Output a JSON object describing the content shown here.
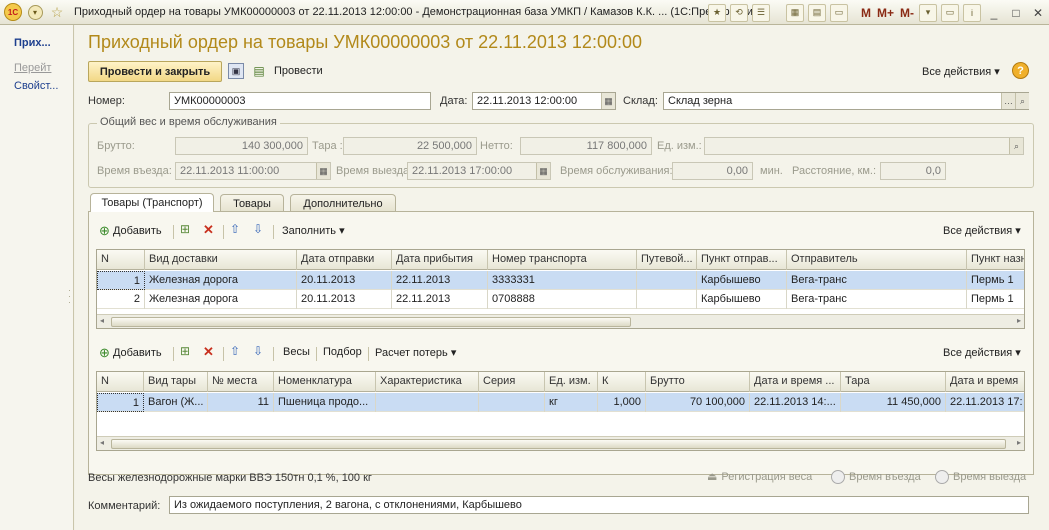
{
  "window": {
    "title": "Приходный ордер на товары УМК00000003 от 22.11.2013 12:00:00 - Демонстрационная база УМКП / Камазов К.К. ... (1С:Предприятие)",
    "toolbar_m": "M",
    "toolbar_mplus": "M+",
    "toolbar_mminus": "M-"
  },
  "sidebar": {
    "items": [
      {
        "label": "Прих..."
      },
      {
        "label": "Перейт"
      },
      {
        "label": "Свойст..."
      }
    ]
  },
  "form": {
    "title": "Приходный ордер на товары УМК00000003 от 22.11.2013 12:00:00",
    "post_close": "Провести и закрыть",
    "post": "Провести",
    "all_actions": "Все действия",
    "help": "?"
  },
  "header": {
    "number_label": "Номер:",
    "number": "УМК00000003",
    "date_label": "Дата:",
    "date": "22.11.2013 12:00:00",
    "warehouse_label": "Склад:",
    "warehouse": "Склад зерна"
  },
  "weights": {
    "group_title": "Общий вес и время обслуживания",
    "gross_label": "Брутто:",
    "gross": "140 300,000",
    "tare_label": "Тара :",
    "tare": "22 500,000",
    "net_label": "Нетто:",
    "net": "117 800,000",
    "unit_label": "Ед. изм.:",
    "unit": "",
    "entry_label": "Время въезда:",
    "entry": "22.11.2013 11:00:00",
    "exit_label": "Время выезда:",
    "exit": "22.11.2013 17:00:00",
    "service_label": "Время обслуживания:",
    "service": "0,00",
    "min_label": "мин.",
    "distance_label": "Расстояние, км.:",
    "distance": "0,0"
  },
  "tabs": [
    {
      "label": "Товары (Транспорт)"
    },
    {
      "label": "Товары"
    },
    {
      "label": "Дополнительно"
    }
  ],
  "transport_toolbar": {
    "add": "Добавить",
    "fill": "Заполнить",
    "all_actions": "Все действия"
  },
  "transport_table": {
    "columns": [
      "N",
      "Вид доставки",
      "Дата отправки",
      "Дата прибытия",
      "Номер транспорта",
      "Путевой...",
      "Пункт отправ...",
      "Отправитель",
      "Пункт назн"
    ],
    "rows": [
      [
        "1",
        "Железная дорога",
        "20.11.2013",
        "22.11.2013",
        "3333331",
        "",
        "Карбышево",
        "Вега-транс",
        "Пермь 1"
      ],
      [
        "2",
        "Железная дорога",
        "20.11.2013",
        "22.11.2013",
        "0708888",
        "",
        "Карбышево",
        "Вега-транс",
        "Пермь 1"
      ]
    ]
  },
  "goods_toolbar": {
    "add": "Добавить",
    "weights": "Весы",
    "pick": "Подбор",
    "loss": "Расчет потерь",
    "all_actions": "Все действия"
  },
  "goods_table": {
    "columns": [
      "N",
      "Вид тары",
      "№ места",
      "Номенклатура",
      "Характеристика",
      "Серия",
      "Ед. изм.",
      "К",
      "Брутто",
      "Дата и время ...",
      "Тара",
      "Дата и время"
    ],
    "rows": [
      [
        "1",
        "Вагон (Ж...",
        "11",
        "Пшеница продо...",
        "",
        "",
        "кг",
        "1,000",
        "70 100,000",
        "22.11.2013 14:...",
        "11 450,000",
        "22.11.2013 17:"
      ]
    ]
  },
  "footer": {
    "scale": "Весы железнодорожные марки ВВЭ 150тн 0,1 %, 100 кг",
    "reg_weight": "Регистрация веса",
    "entry_time": "Время въезда",
    "exit_time": "Время выезда",
    "comment_label": "Комментарий:",
    "comment": "Из ожидаемого поступления, 2 вагона, с отклонениями, Карбышево"
  }
}
